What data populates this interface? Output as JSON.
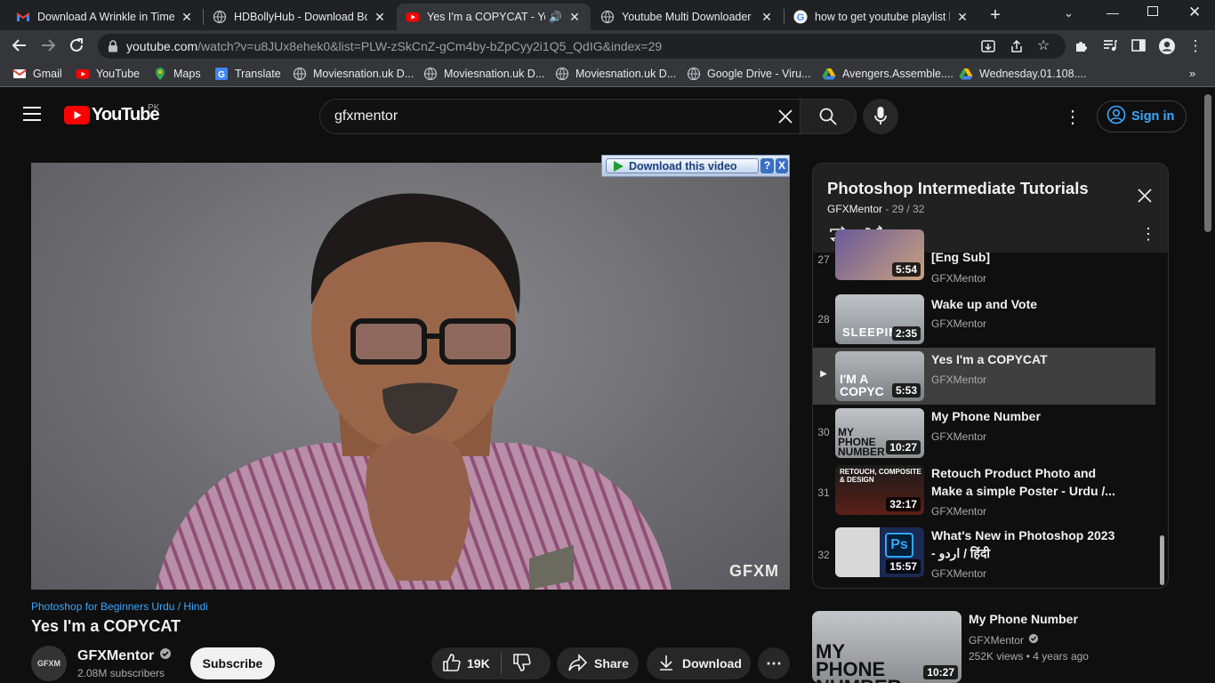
{
  "browser": {
    "tabs": [
      {
        "title": "Download A Wrinkle in Time",
        "favicon": "gmail-icon"
      },
      {
        "title": "HDBollyHub - Download Boll",
        "favicon": "globe-icon"
      },
      {
        "title": "Yes I'm a COPYCAT - You",
        "favicon": "youtube-icon",
        "active": true
      },
      {
        "title": "Youtube Multi Downloader C",
        "favicon": "globe-icon"
      },
      {
        "title": "how to get youtube playlist l",
        "favicon": "google-icon"
      }
    ],
    "url_host": "youtube.com",
    "url_path": "/watch?v=u8JUx8ehek0&list=PLW-zSkCnZ-gCm4by-bZpCyy2i1Q5_QdIG&index=29",
    "bookmarks": [
      {
        "label": "Gmail",
        "icon": "gmail-icon"
      },
      {
        "label": "YouTube",
        "icon": "youtube-icon"
      },
      {
        "label": "Maps",
        "icon": "maps-icon"
      },
      {
        "label": "Translate",
        "icon": "translate-icon"
      },
      {
        "label": "Moviesnation.uk D...",
        "icon": "globe-icon"
      },
      {
        "label": "Moviesnation.uk D...",
        "icon": "globe-icon"
      },
      {
        "label": "Moviesnation.uk D...",
        "icon": "globe-icon"
      },
      {
        "label": "Google Drive - Viru...",
        "icon": "globe-icon"
      },
      {
        "label": "Avengers.Assemble....",
        "icon": "drive-icon"
      },
      {
        "label": "Wednesday.01.108....",
        "icon": "drive-icon"
      }
    ]
  },
  "youtube": {
    "logo_text": "YouTube",
    "country": "PK",
    "search_value": "gfxmentor",
    "signin_label": "Sign in"
  },
  "download_bar": {
    "label": "Download this video",
    "help": "?",
    "close": "X"
  },
  "video": {
    "watermark": "GFXM",
    "hashtag": "Photoshop for Beginners Urdu / Hindi",
    "title": "Yes I'm a COPYCAT",
    "channel": "GFXMentor",
    "subscribers": "2.08M subscribers",
    "subscribe_label": "Subscribe",
    "avatar_text": "GFXM",
    "likes": "19K",
    "share_label": "Share",
    "download_label": "Download",
    "more_label": "⋯"
  },
  "playlist": {
    "title": "Photoshop Intermediate Tutorials",
    "channel": "GFXMentor",
    "position": "29 / 32",
    "items": [
      {
        "index": "27",
        "title": "[Eng Sub]",
        "channel": "GFXMentor",
        "duration": "5:54",
        "thumb_text": ""
      },
      {
        "index": "28",
        "title": "Wake up and Vote",
        "channel": "GFXMentor",
        "duration": "2:35",
        "thumb_text": "SLEEPIN"
      },
      {
        "index": "▶",
        "title": "Yes I'm a COPYCAT",
        "channel": "GFXMentor",
        "duration": "5:53",
        "thumb_text": "I'M A COPYC",
        "current": true
      },
      {
        "index": "30",
        "title": "My Phone Number",
        "channel": "GFXMentor",
        "duration": "10:27",
        "thumb_text": "MY PHONE NUMBER"
      },
      {
        "index": "31",
        "title": "Retouch Product Photo and Make a simple Poster - Urdu /...",
        "channel": "GFXMentor",
        "duration": "32:17",
        "thumb_text": "RETOUCH, COMPOSITE & DESIGN"
      },
      {
        "index": "32",
        "title": "What's New in Photoshop 2023 - اردو / हिंदी",
        "channel": "GFXMentor",
        "duration": "15:57",
        "thumb_text": "Ps"
      }
    ]
  },
  "recommended": {
    "title": "My Phone Number",
    "channel": "GFXMentor",
    "views": "252K views",
    "age": "4 years ago",
    "thumb_text": "MY PHONE NUMBER",
    "duration": "10:27"
  },
  "colors": {
    "accent": "#3ea6ff",
    "youtube_red": "#ff0000",
    "background": "#0f0f0f"
  }
}
